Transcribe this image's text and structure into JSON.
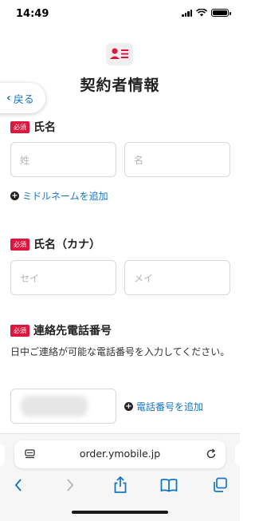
{
  "status": {
    "time": "14:49"
  },
  "header": {
    "title": "契約者情報",
    "back_label": "戻る"
  },
  "name_section": {
    "badge": "必須",
    "label": "氏名",
    "last_placeholder": "姓",
    "first_placeholder": "名",
    "add_middle_name": "ミドルネームを追加"
  },
  "kana_section": {
    "badge": "必須",
    "label": "氏名（カナ）",
    "last_placeholder": "セイ",
    "first_placeholder": "メイ"
  },
  "phone_section": {
    "badge": "必須",
    "label": "連絡先電話番号",
    "help": "日中ご連絡が可能な電話番号を入力してください。",
    "add_phone": "電話番号を追加"
  },
  "browser": {
    "url": "order.ymobile.jp"
  },
  "colors": {
    "accent": "#1677c7",
    "badge": "#e0143c",
    "header_icon": "#e0143c"
  }
}
